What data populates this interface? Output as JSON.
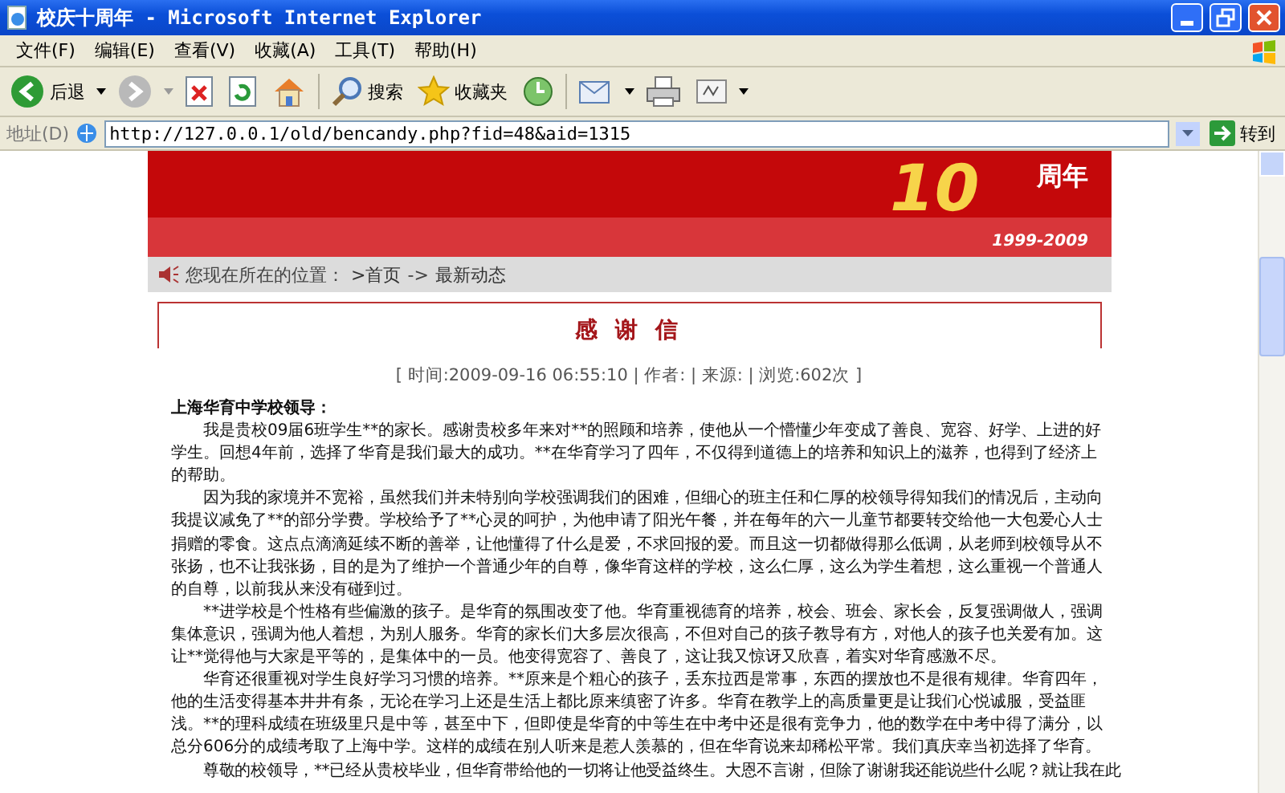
{
  "window": {
    "title": "校庆十周年 - Microsoft Internet Explorer"
  },
  "menu": [
    "文件(F)",
    "编辑(E)",
    "查看(V)",
    "收藏(A)",
    "工具(T)",
    "帮助(H)"
  ],
  "toolbar": {
    "back": "后退",
    "search": "搜索",
    "favorites": "收藏夹"
  },
  "address_bar": {
    "label": "地址(D)",
    "url": "http://127.0.0.1/old/bencandy.php?fid=48&aid=1315",
    "go": "转到"
  },
  "banner": {
    "number": "10",
    "suffix": "周年",
    "years": "1999-2009"
  },
  "breadcrumb": {
    "label": "您现在所在的位置：",
    "links": [
      ">首页",
      "最新动态"
    ],
    "separator": "->"
  },
  "article": {
    "title": "感 谢 信",
    "meta": "[ 时间:2009-09-16 06:55:10 | 作者: | 来源: | 浏览:602次 ]",
    "salutation": "上海华育中学校领导：",
    "paragraphs": [
      "我是贵校09届6班学生**的家长。感谢贵校多年来对**的照顾和培养，使他从一个懵懂少年变成了善良、宽容、好学、上进的好学生。回想4年前，选择了华育是我们最大的成功。**在华育学习了四年，不仅得到道德上的培养和知识上的滋养，也得到了经济上的帮助。",
      "因为我的家境并不宽裕，虽然我们并未特别向学校强调我们的困难，但细心的班主任和仁厚的校领导得知我们的情况后，主动向我提议减免了**的部分学费。学校给予了**心灵的呵护，为他申请了阳光午餐，并在每年的六一儿童节都要转交给他一大包爱心人士捐赠的零食。这点点滴滴延续不断的善举，让他懂得了什么是爱，不求回报的爱。而且这一切都做得那么低调，从老师到校领导从不张扬，也不让我张扬，目的是为了维护一个普通少年的自尊，像华育这样的学校，这么仁厚，这么为学生着想，这么重视一个普通人的自尊，以前我从来没有碰到过。",
      "**进学校是个性格有些偏激的孩子。是华育的氛围改变了他。华育重视德育的培养，校会、班会、家长会，反复强调做人，强调集体意识，强调为他人着想，为别人服务。华育的家长们大多层次很高，不但对自己的孩子教导有方，对他人的孩子也关爱有加。这让**觉得他与大家是平等的，是集体中的一员。他变得宽容了、善良了，这让我又惊讶又欣喜，着实对华育感激不尽。",
      "华育还很重视对学生良好学习习惯的培养。**原来是个粗心的孩子，丢东拉西是常事，东西的摆放也不是很有规律。华育四年，他的生活变得基本井井有条，无论在学习上还是生活上都比原来缜密了许多。华育在教学上的高质量更是让我们心悦诚服，受益匪浅。**的理科成绩在班级里只是中等，甚至中下，但即使是华育的中等生在中考中还是很有竞争力，他的数学在中考中得了满分，以总分606分的成绩考取了上海中学。这样的成绩在别人听来是惹人羡慕的，但在华育说来却稀松平常。我们真庆幸当初选择了华育。",
      "尊敬的校领导，**已经从贵校毕业，但华育带给他的一切将让他受益终生。大恩不言谢，但除了谢谢我还能说些什么呢？就让我在此"
    ]
  }
}
